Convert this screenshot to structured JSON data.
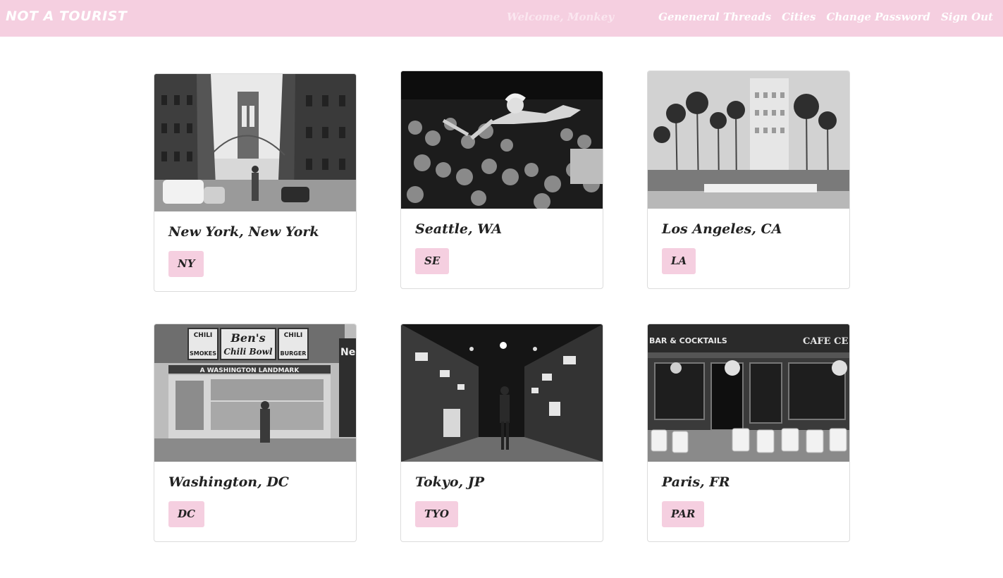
{
  "navbar": {
    "brand": "NOT A TOURIST",
    "welcome": "Welcome, Monkey",
    "links": [
      "Geneneral Threads",
      "Cities",
      "Change Password",
      "Sign Out"
    ]
  },
  "cities": [
    {
      "name": "New York, New York",
      "code": "NY"
    },
    {
      "name": "Seattle, WA",
      "code": "SE"
    },
    {
      "name": "Los Angeles, CA",
      "code": "LA"
    },
    {
      "name": "Washington, DC",
      "code": "DC"
    },
    {
      "name": "Tokyo, JP",
      "code": "TYO"
    },
    {
      "name": "Paris, FR",
      "code": "PAR"
    }
  ],
  "photo_signs": {
    "dc_left": "CHILI",
    "dc_left2": "SMOKES",
    "dc_center": "Ben's",
    "dc_center2": "Chili Bowl",
    "dc_right": "CHILI",
    "dc_right2": "BURGER",
    "dc_strip": "A WASHINGTON LANDMARK",
    "dc_edge": "Ne",
    "paris_left": "BAR & COCKTAILS",
    "paris_right": "CAFE CE"
  },
  "colors": {
    "accent": "#f5cfe0",
    "border": "#dcdcdc",
    "text": "#222222"
  }
}
